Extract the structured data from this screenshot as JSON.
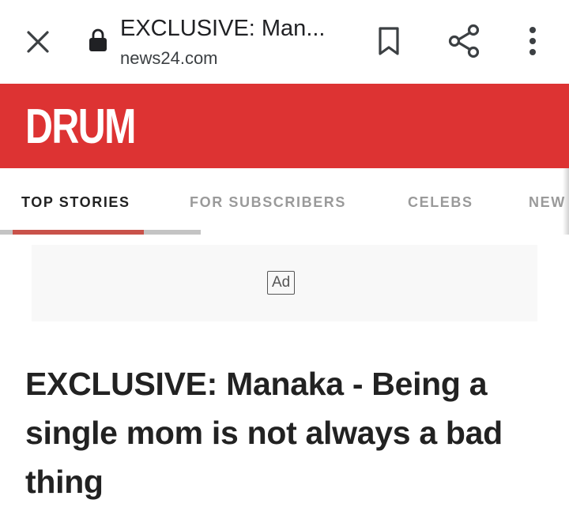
{
  "toolbar": {
    "page_title": "EXCLUSIVE: Man...",
    "domain": "news24.com",
    "icons": [
      "close-icon",
      "lock-icon",
      "bookmark-icon",
      "share-icon",
      "more-vert-icon"
    ]
  },
  "site": {
    "logo_text": "DRUM",
    "brand_color": "#dd3333"
  },
  "nav": {
    "tabs": [
      {
        "label": "TOP STORIES",
        "active": true
      },
      {
        "label": "FOR SUBSCRIBERS",
        "active": false
      },
      {
        "label": "CELEBS",
        "active": false
      },
      {
        "label": "NEW",
        "active": false
      }
    ]
  },
  "ad": {
    "label": "Ad"
  },
  "article": {
    "headline": "EXCLUSIVE: Manaka - Being a single mom is not always a bad thing"
  }
}
